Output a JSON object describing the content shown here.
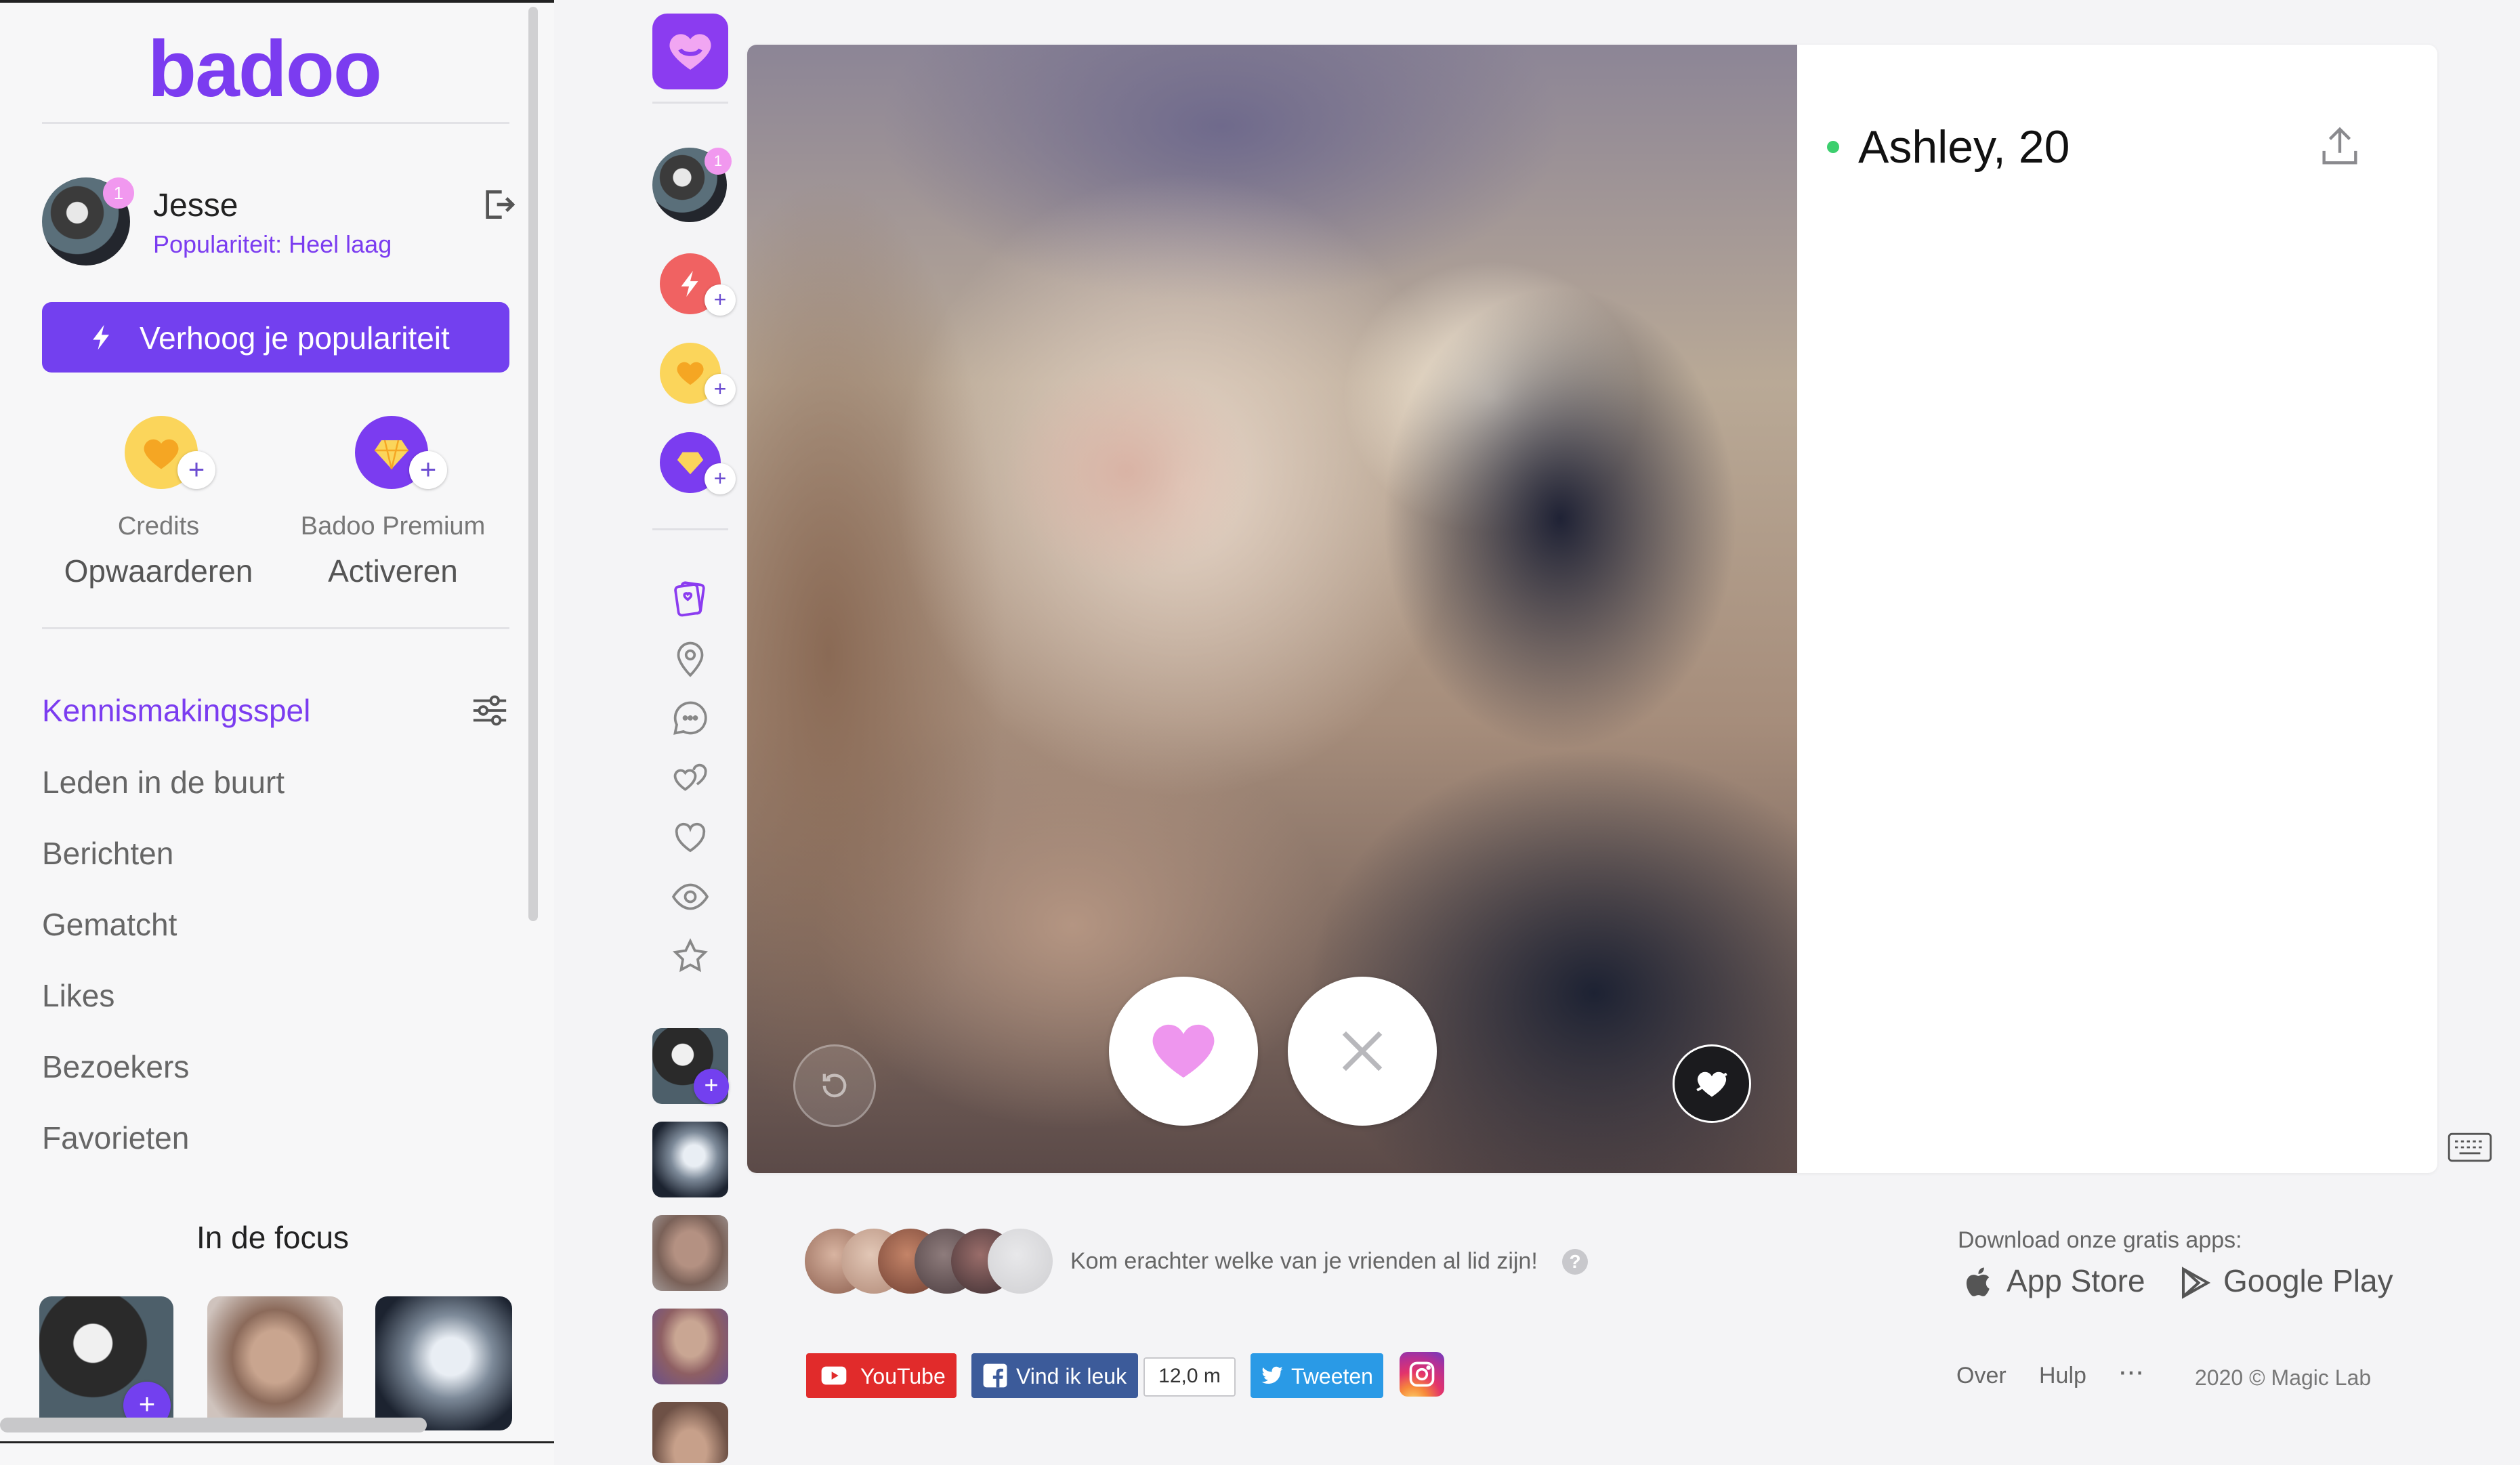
{
  "brand": {
    "logo_text": "badoo",
    "accent": "#7b3cf0"
  },
  "user": {
    "name": "Jesse",
    "popularity": "Populariteit: Heel laag",
    "notification_count": "1"
  },
  "boost": {
    "label": "Verhoog je populariteit"
  },
  "upgrades": [
    {
      "title": "Credits",
      "action": "Opwaarderen",
      "icon": "heart-coin-icon"
    },
    {
      "title": "Badoo Premium",
      "action": "Activeren",
      "icon": "diamond-icon"
    }
  ],
  "nav": {
    "items": [
      {
        "label": "Kennismakingsspel",
        "active": true
      },
      {
        "label": "Leden in de buurt"
      },
      {
        "label": "Berichten"
      },
      {
        "label": "Gematcht"
      },
      {
        "label": "Likes"
      },
      {
        "label": "Bezoekers"
      },
      {
        "label": "Favorieten"
      }
    ],
    "filter_icon": "sliders-icon"
  },
  "focus": {
    "title": "In de focus"
  },
  "rail": {
    "badge": "1",
    "icons": [
      "cards-icon",
      "location-pin-icon",
      "chat-icon",
      "hearts-icon",
      "heart-outline-icon",
      "eye-icon",
      "star-icon"
    ]
  },
  "profile": {
    "name_age": "Ashley, 20",
    "online": true
  },
  "actions": {
    "like": "heart-icon",
    "pass": "close-icon",
    "undo": "undo-icon",
    "crush": "crush-icon"
  },
  "footer": {
    "friends_text": "Kom erachter welke van je vrienden al lid zijn!",
    "help_mark": "?",
    "download_text": "Download onze gratis apps:",
    "appstore": "App Store",
    "googleplay": "Google Play",
    "youtube": "YouTube",
    "facebook": "Vind ik leuk",
    "facebook_count": "12,0 m",
    "twitter": "Tweeten",
    "links": [
      "Over",
      "Hulp"
    ],
    "more": "···",
    "copyright": "2020 © Magic Lab"
  }
}
